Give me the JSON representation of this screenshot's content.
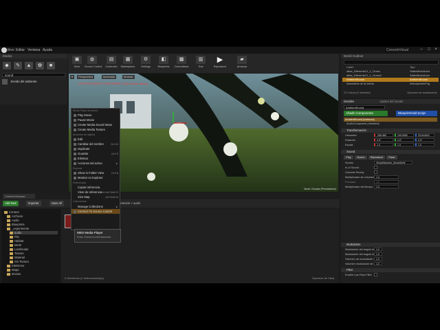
{
  "menubar": {
    "items": [
      "Archivo",
      "Editar",
      "Ventana",
      "Ayuda"
    ],
    "project_title": "ConsoleVisual"
  },
  "modes": {
    "tab_label": "Modos",
    "search_value": "sound",
    "result_label": "Sonido del ambiente"
  },
  "toolbar": {
    "buttons": [
      "Save",
      "Source Control",
      "Contenido",
      "Marketplace",
      "Settings",
      "Blueprints",
      "Cinemáticas",
      "Tirar",
      "Reproducir",
      "Arrancar"
    ]
  },
  "viewport": {
    "buttons": [
      "Perspectiva",
      "Iluminado",
      "Mostrar"
    ],
    "warning": "LIGHTING NEEDS TO BE REBUILT (106 unbuilt objects)",
    "level_label": "Nivel:  Escala (Persistente)"
  },
  "context_menu": {
    "sections": [
      "Media Player Acciones",
      "Acciones de objetos",
      "Explorar",
      "Referencias",
      "Colecciones"
    ],
    "items": [
      "Play Movie",
      "Pause Movie",
      "Create Media Sound Wave",
      "Create Media Texture",
      "Edit",
      "Cambiar del nombre",
      "Duplicate",
      "Guardar",
      "Eliminar",
      "Acciones del activo",
      "Show in Folder View",
      "Mostrar en Explorer",
      "Copiar referencia",
      "Visor de referencia",
      "Size Map",
      "Manage Collections",
      "Connect To Source Control"
    ],
    "shortcuts": [
      "Ctrl+W",
      "Ctrl+S",
      "Ctrl+B",
      "Ctrl+Alt+Shift+R",
      "Alt+Shift+M"
    ]
  },
  "tooltip": {
    "title": "0802 Media Player",
    "path_label": "Ruta: /Game/contenido/audio"
  },
  "content_browser": {
    "tab_label": "Content Browser",
    "add_new": "Add New",
    "import": "Importar",
    "save_all": "Save All",
    "breadcrumb": "Contenido  >  audio",
    "tree": [
      "Content",
      "Archivos",
      "Audio",
      "Blueprints",
      "_experimente",
      "audio",
      "Fbx",
      "Habitat",
      "Mesh",
      "Landscape",
      "Texture",
      "Material",
      "Sin Textura",
      "KiteDemo",
      "Mapa",
      "Movies"
    ],
    "status": "2 elementos (1 seleccionado(s))",
    "view_options": "Opciones de Vista"
  },
  "outliner": {
    "tab_label": "World Outliner",
    "col_label": "Label",
    "col_type": "Tipo",
    "rows": [
      {
        "label": "alfas_Diferente21_1_Grass",
        "type": "StaticMeshActor"
      },
      {
        "label": "alfas_Diferente21_1_Grass2",
        "type": "StaticMeshActor"
      },
      {
        "label": "AmbientSound",
        "type": "AmbientSound"
      },
      {
        "label": "Atmósfera de la niebla",
        "type": "AtmosphericFog"
      }
    ],
    "count": "217 actors (1 selected)",
    "view_options": "Opciones de visualización"
  },
  "details": {
    "tab_details": "Detalles",
    "tab_world": "Ajustes del mundo",
    "actor_name": "AmbientSound",
    "add_component": "Añadir Componente",
    "blueprint_btn": "Blueprint/Add Script",
    "instance": "AmbientSound (Instance)",
    "audio_comp": "AudioComponent (Inherited)",
    "transform": {
      "title": "Transformación",
      "ubicacion": "Ubicación",
      "rotacion": "Rotación",
      "escala": "Escala",
      "loc": [
        "-256.989",
        "100.0605",
        "33.044403"
      ],
      "rot": [
        "0.0°",
        "0.0°",
        "0.0°"
      ],
      "scale": [
        "1.0",
        "1.0",
        "1.0"
      ]
    },
    "sound": {
      "title": "Sound",
      "buttons": [
        "Play",
        "Nuevo",
        "Reproducir",
        "Parar"
      ],
      "fields": [
        "Sonido",
        "Is UI Sound",
        "Override Priority",
        "Multiplicador de volumen",
        "Prioridad",
        "Multiplicador del tiempo"
      ],
      "sonido_value": "/Script/Nombre_MovieDeW",
      "volume": "1.0",
      "priority": "1.0",
      "pitch": "1.0"
    },
    "attenuation": {
      "title": "Attenuation",
      "fields": [
        "Permitir la espacialización",
        "Sustituir la atenuación",
        "Ajustes de atenuación"
      ],
      "ajustes_value": "Ninguno"
    },
    "modulation": {
      "title": "Modulation",
      "fields": [
        "Modulación del ángulo min",
        "Modulación del ángulo máx",
        "Volumen de modulación min",
        "Volumen modulación de max"
      ],
      "values": [
        "1.0",
        "1.0",
        "1.0",
        "1.0"
      ]
    },
    "filter": {
      "title": "Filter",
      "field": "Enable Low Pass Filter"
    }
  }
}
